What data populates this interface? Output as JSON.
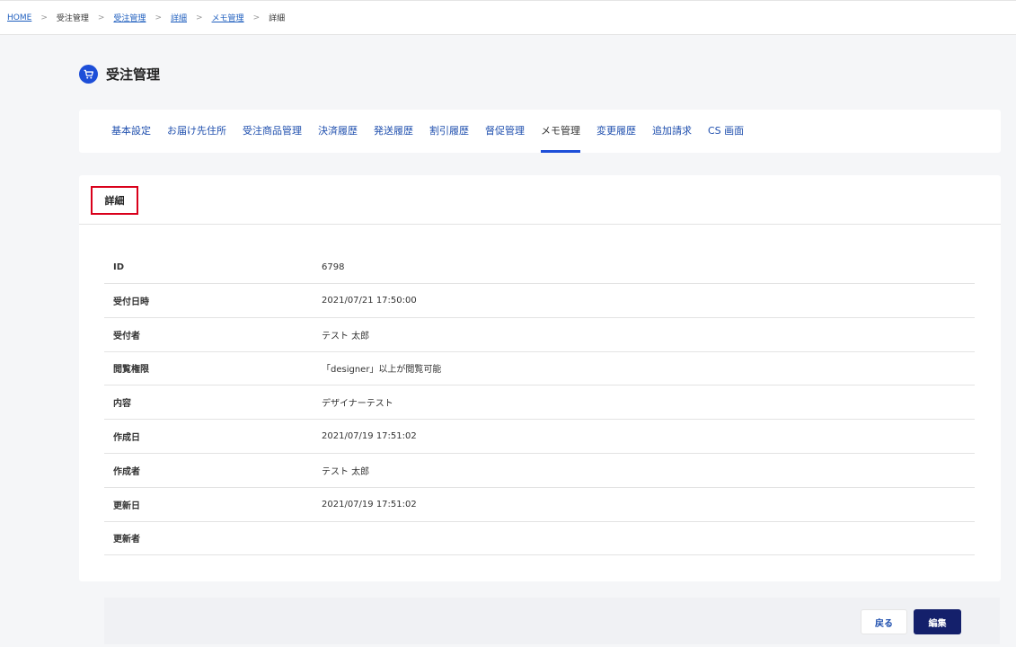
{
  "breadcrumb": [
    {
      "label": "HOME",
      "link": true
    },
    {
      "label": "受注管理",
      "link": false
    },
    {
      "label": "受注管理",
      "link": true
    },
    {
      "label": "詳細",
      "link": true
    },
    {
      "label": "メモ管理",
      "link": true
    },
    {
      "label": "詳細",
      "link": false
    }
  ],
  "page": {
    "title": "受注管理",
    "icon": "cart-icon"
  },
  "tabs": [
    {
      "label": "基本設定"
    },
    {
      "label": "お届け先住所"
    },
    {
      "label": "受注商品管理"
    },
    {
      "label": "決済履歴"
    },
    {
      "label": "発送履歴"
    },
    {
      "label": "割引履歴"
    },
    {
      "label": "督促管理"
    },
    {
      "label": "メモ管理",
      "active": true
    },
    {
      "label": "変更履歴"
    },
    {
      "label": "追加請求"
    },
    {
      "label": "CS 画面"
    }
  ],
  "card": {
    "title": "詳細"
  },
  "details": [
    {
      "label": "ID",
      "value": "6798"
    },
    {
      "label": "受付日時",
      "value": "2021/07/21 17:50:00"
    },
    {
      "label": "受付者",
      "value": "テスト 太郎"
    },
    {
      "label": "閲覧権限",
      "value": "「designer」以上が閲覧可能"
    },
    {
      "label": "内容",
      "value": "デザイナーテスト"
    },
    {
      "label": "作成日",
      "value": "2021/07/19 17:51:02"
    },
    {
      "label": "作成者",
      "value": "テスト 太郎"
    },
    {
      "label": "更新日",
      "value": "2021/07/19 17:51:02"
    },
    {
      "label": "更新者",
      "value": ""
    }
  ],
  "buttons": {
    "back": "戻る",
    "edit": "編集"
  },
  "colors": {
    "accent": "#1d4ed8",
    "primary_button": "#14206b",
    "highlight_border": "#d9001b"
  }
}
